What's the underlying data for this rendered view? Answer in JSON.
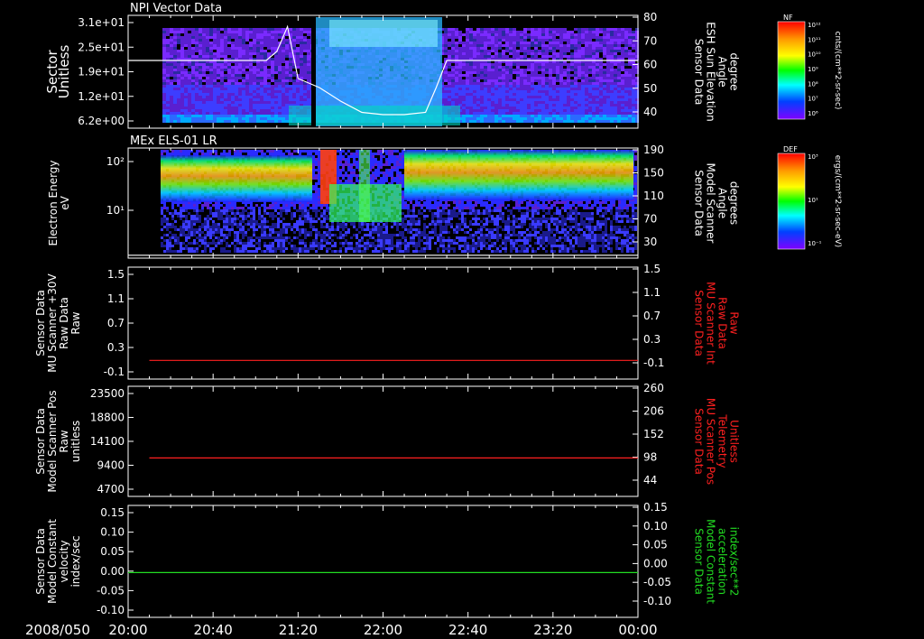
{
  "date_label": "2008/050",
  "time_axis": {
    "start": "20:00",
    "end": "00:00",
    "tick_labels": [
      "20:00",
      "20:40",
      "21:20",
      "22:00",
      "22:40",
      "23:20",
      "00:00"
    ]
  },
  "colors": {
    "red": "#ff2020",
    "green": "#22dd22",
    "white": "#ffffff"
  },
  "colorbars": [
    {
      "label": "NF",
      "unit": "cnts/(cm**2-sr-sec)",
      "ticks": [
        "10¹²",
        "10¹¹",
        "10¹⁰",
        "10⁹",
        "10⁸",
        "10⁷",
        "10⁶"
      ]
    },
    {
      "label": "DEF",
      "unit": "ergs/(cm**2-sr-sec-eV)",
      "ticks": [
        "10³",
        "10¹",
        "10⁻¹"
      ]
    }
  ],
  "chart_data": [
    {
      "type": "heatmap",
      "title": "NPI Vector Data",
      "ylabel": [
        "Sector",
        "Unitless"
      ],
      "ytick_labels": [
        "3.1e+01",
        "2.5e+01",
        "1.9e+01",
        "1.2e+01",
        "6.2e+00"
      ],
      "y2label": [
        "Sensor Data",
        "ESH Sun Elevation",
        "Angle",
        "degree"
      ],
      "y2tick_labels": [
        "80",
        "70",
        "60",
        "50",
        "40"
      ],
      "overlay_line": {
        "name": "ESH Sun Elevation Angle",
        "x": [
          "20:00",
          "21:05",
          "21:10",
          "21:15",
          "21:20",
          "21:30",
          "21:40",
          "21:50",
          "22:00",
          "22:10",
          "22:20",
          "22:25",
          "22:30",
          "23:20",
          "00:00"
        ],
        "y": [
          60,
          60,
          64,
          75,
          52,
          48,
          42,
          37,
          36,
          36,
          37,
          48,
          60,
          60,
          60
        ],
        "ylim": [
          30,
          80
        ]
      }
    },
    {
      "type": "heatmap",
      "title": "MEx ELS-01 LR",
      "ylabel": [
        "Electron Energy",
        "eV"
      ],
      "ytick_labels": [
        "10²",
        "10¹"
      ],
      "y2label": [
        "Sensor Data",
        "Model Scanner",
        "Angle",
        "degrees"
      ],
      "y2tick_labels": [
        "190",
        "150",
        "110",
        "70",
        "30"
      ],
      "overlay_line": {
        "name": "Model Scanner Angle",
        "x": [
          "20:00",
          "00:00"
        ],
        "y": [
          5,
          5
        ],
        "ylim": [
          0,
          190
        ]
      }
    },
    {
      "type": "line",
      "ylabel": [
        "Sensor Data",
        "MU Scanner +30V",
        "Raw Data",
        "Raw"
      ],
      "ytick_labels": [
        "1.5",
        "1.1",
        "0.7",
        "0.3",
        "-0.1"
      ],
      "ylim": [
        -0.3,
        1.5
      ],
      "y2label": [
        "Sensor Data",
        "MU Scanner Int",
        "Raw Data",
        "Raw"
      ],
      "y2tick_labels": [
        "1.5",
        "1.1",
        "0.7",
        "0.3",
        "-0.1"
      ],
      "series": [
        {
          "color": "#ff2020",
          "x": [
            "20:10",
            "00:00"
          ],
          "y": [
            0.0,
            0.0
          ]
        }
      ]
    },
    {
      "type": "line",
      "ylabel": [
        "Sensor Data",
        "Model Scanner Pos",
        "Raw",
        "unitless"
      ],
      "ytick_labels": [
        "23500",
        "18800",
        "14100",
        "9400",
        "4700"
      ],
      "ylim": [
        0,
        23500
      ],
      "y2label": [
        "Sensor Data",
        "MU Scanner Pos",
        "Telemetry",
        "Unitless"
      ],
      "y2tick_labels": [
        "260",
        "206",
        "152",
        "98",
        "44"
      ],
      "series": [
        {
          "color": "#ff2020",
          "x": [
            "20:10",
            "00:00"
          ],
          "y": [
            8200,
            8200
          ]
        }
      ]
    },
    {
      "type": "line",
      "ylabel": [
        "Sensor Data",
        "Model Constant",
        "velocity",
        "index/sec"
      ],
      "ytick_labels": [
        "0.15",
        "0.10",
        "0.05",
        "0.00",
        "-0.05",
        "-0.10"
      ],
      "ylim": [
        -0.1,
        0.15
      ],
      "y2label": [
        "Sensor Data",
        "Model Constant",
        "acceleration",
        "index/sec**2"
      ],
      "y2tick_labels": [
        "0.15",
        "0.10",
        "0.05",
        "0.00",
        "-0.05",
        "-0.10"
      ],
      "series": [
        {
          "color": "#22dd22",
          "x": [
            "20:00",
            "00:00"
          ],
          "y": [
            0.0,
            0.0
          ]
        }
      ]
    }
  ]
}
